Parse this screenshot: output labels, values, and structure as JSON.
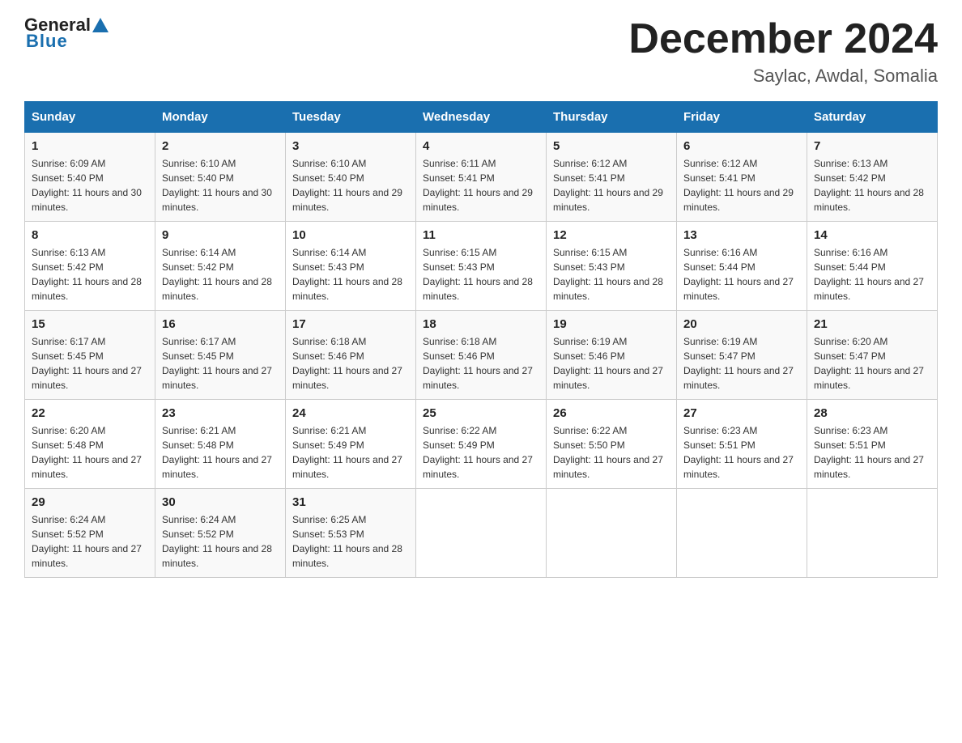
{
  "header": {
    "logo_general": "General",
    "logo_blue": "Blue",
    "month_title": "December 2024",
    "location": "Saylac, Awdal, Somalia"
  },
  "weekdays": [
    "Sunday",
    "Monday",
    "Tuesday",
    "Wednesday",
    "Thursday",
    "Friday",
    "Saturday"
  ],
  "weeks": [
    [
      {
        "day": "1",
        "sunrise": "6:09 AM",
        "sunset": "5:40 PM",
        "daylight": "11 hours and 30 minutes."
      },
      {
        "day": "2",
        "sunrise": "6:10 AM",
        "sunset": "5:40 PM",
        "daylight": "11 hours and 30 minutes."
      },
      {
        "day": "3",
        "sunrise": "6:10 AM",
        "sunset": "5:40 PM",
        "daylight": "11 hours and 29 minutes."
      },
      {
        "day": "4",
        "sunrise": "6:11 AM",
        "sunset": "5:41 PM",
        "daylight": "11 hours and 29 minutes."
      },
      {
        "day": "5",
        "sunrise": "6:12 AM",
        "sunset": "5:41 PM",
        "daylight": "11 hours and 29 minutes."
      },
      {
        "day": "6",
        "sunrise": "6:12 AM",
        "sunset": "5:41 PM",
        "daylight": "11 hours and 29 minutes."
      },
      {
        "day": "7",
        "sunrise": "6:13 AM",
        "sunset": "5:42 PM",
        "daylight": "11 hours and 28 minutes."
      }
    ],
    [
      {
        "day": "8",
        "sunrise": "6:13 AM",
        "sunset": "5:42 PM",
        "daylight": "11 hours and 28 minutes."
      },
      {
        "day": "9",
        "sunrise": "6:14 AM",
        "sunset": "5:42 PM",
        "daylight": "11 hours and 28 minutes."
      },
      {
        "day": "10",
        "sunrise": "6:14 AM",
        "sunset": "5:43 PM",
        "daylight": "11 hours and 28 minutes."
      },
      {
        "day": "11",
        "sunrise": "6:15 AM",
        "sunset": "5:43 PM",
        "daylight": "11 hours and 28 minutes."
      },
      {
        "day": "12",
        "sunrise": "6:15 AM",
        "sunset": "5:43 PM",
        "daylight": "11 hours and 28 minutes."
      },
      {
        "day": "13",
        "sunrise": "6:16 AM",
        "sunset": "5:44 PM",
        "daylight": "11 hours and 27 minutes."
      },
      {
        "day": "14",
        "sunrise": "6:16 AM",
        "sunset": "5:44 PM",
        "daylight": "11 hours and 27 minutes."
      }
    ],
    [
      {
        "day": "15",
        "sunrise": "6:17 AM",
        "sunset": "5:45 PM",
        "daylight": "11 hours and 27 minutes."
      },
      {
        "day": "16",
        "sunrise": "6:17 AM",
        "sunset": "5:45 PM",
        "daylight": "11 hours and 27 minutes."
      },
      {
        "day": "17",
        "sunrise": "6:18 AM",
        "sunset": "5:46 PM",
        "daylight": "11 hours and 27 minutes."
      },
      {
        "day": "18",
        "sunrise": "6:18 AM",
        "sunset": "5:46 PM",
        "daylight": "11 hours and 27 minutes."
      },
      {
        "day": "19",
        "sunrise": "6:19 AM",
        "sunset": "5:46 PM",
        "daylight": "11 hours and 27 minutes."
      },
      {
        "day": "20",
        "sunrise": "6:19 AM",
        "sunset": "5:47 PM",
        "daylight": "11 hours and 27 minutes."
      },
      {
        "day": "21",
        "sunrise": "6:20 AM",
        "sunset": "5:47 PM",
        "daylight": "11 hours and 27 minutes."
      }
    ],
    [
      {
        "day": "22",
        "sunrise": "6:20 AM",
        "sunset": "5:48 PM",
        "daylight": "11 hours and 27 minutes."
      },
      {
        "day": "23",
        "sunrise": "6:21 AM",
        "sunset": "5:48 PM",
        "daylight": "11 hours and 27 minutes."
      },
      {
        "day": "24",
        "sunrise": "6:21 AM",
        "sunset": "5:49 PM",
        "daylight": "11 hours and 27 minutes."
      },
      {
        "day": "25",
        "sunrise": "6:22 AM",
        "sunset": "5:49 PM",
        "daylight": "11 hours and 27 minutes."
      },
      {
        "day": "26",
        "sunrise": "6:22 AM",
        "sunset": "5:50 PM",
        "daylight": "11 hours and 27 minutes."
      },
      {
        "day": "27",
        "sunrise": "6:23 AM",
        "sunset": "5:51 PM",
        "daylight": "11 hours and 27 minutes."
      },
      {
        "day": "28",
        "sunrise": "6:23 AM",
        "sunset": "5:51 PM",
        "daylight": "11 hours and 27 minutes."
      }
    ],
    [
      {
        "day": "29",
        "sunrise": "6:24 AM",
        "sunset": "5:52 PM",
        "daylight": "11 hours and 27 minutes."
      },
      {
        "day": "30",
        "sunrise": "6:24 AM",
        "sunset": "5:52 PM",
        "daylight": "11 hours and 28 minutes."
      },
      {
        "day": "31",
        "sunrise": "6:25 AM",
        "sunset": "5:53 PM",
        "daylight": "11 hours and 28 minutes."
      },
      null,
      null,
      null,
      null
    ]
  ],
  "labels": {
    "sunrise_prefix": "Sunrise: ",
    "sunset_prefix": "Sunset: ",
    "daylight_prefix": "Daylight: "
  }
}
